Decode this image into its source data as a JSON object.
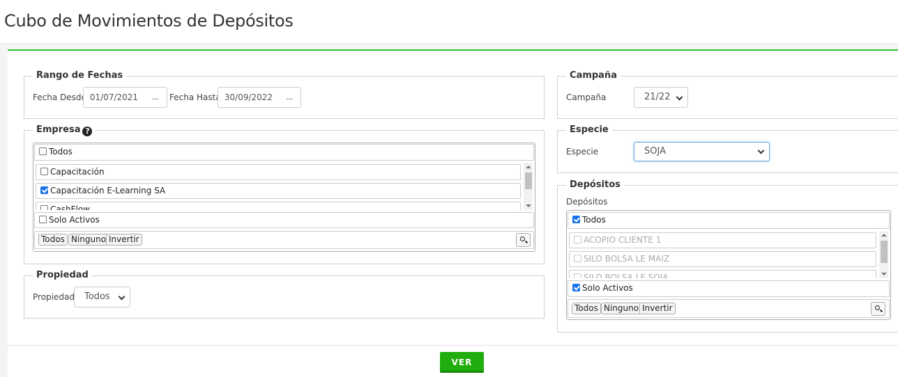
{
  "page": {
    "title": "Cubo de Movimientos de Depósitos"
  },
  "rango_fechas": {
    "legend": "Rango de Fechas",
    "desde_label": "Fecha Desde",
    "desde_value": "01/07/2021",
    "hasta_label": "Fecha Hasta",
    "hasta_value": "30/09/2022",
    "picker_label": "..."
  },
  "empresa": {
    "legend": "Empresa",
    "help_glyph": "?",
    "all_label": "Todos",
    "items": [
      {
        "label": "Capacitación",
        "checked": false
      },
      {
        "label": "Capacitación E-Learning SA",
        "checked": true
      },
      {
        "label": "CashFlow",
        "checked": false
      }
    ],
    "solo_activos_label": "Solo Activos",
    "btn_todos": "Todos",
    "btn_ninguno": "Ninguno",
    "btn_invertir": "Invertir"
  },
  "propiedad": {
    "legend": "Propiedad",
    "label": "Propiedad",
    "value": "Todos"
  },
  "campana": {
    "legend": "Campaña",
    "label": "Campaña",
    "value": "21/22"
  },
  "especie": {
    "legend": "Especie",
    "label": "Especie",
    "value": "SOJA"
  },
  "depositos": {
    "legend": "Depósitos",
    "label": "Depósitos",
    "all_label": "Todos",
    "all_checked": true,
    "items": [
      {
        "label": "ACOPIO CLIENTE 1"
      },
      {
        "label": "SILO BOLSA LE MAIZ"
      },
      {
        "label": "SILO BOLSA LE SOJA"
      }
    ],
    "solo_activos_label": "Solo Activos",
    "solo_activos_checked": true,
    "btn_todos": "Todos",
    "btn_ninguno": "Ninguno",
    "btn_invertir": "Invertir"
  },
  "actions": {
    "ver_label": "VER"
  },
  "colors": {
    "accent": "#27c21f",
    "button": "#1fae0e",
    "checkbox": "#1a73e8"
  }
}
